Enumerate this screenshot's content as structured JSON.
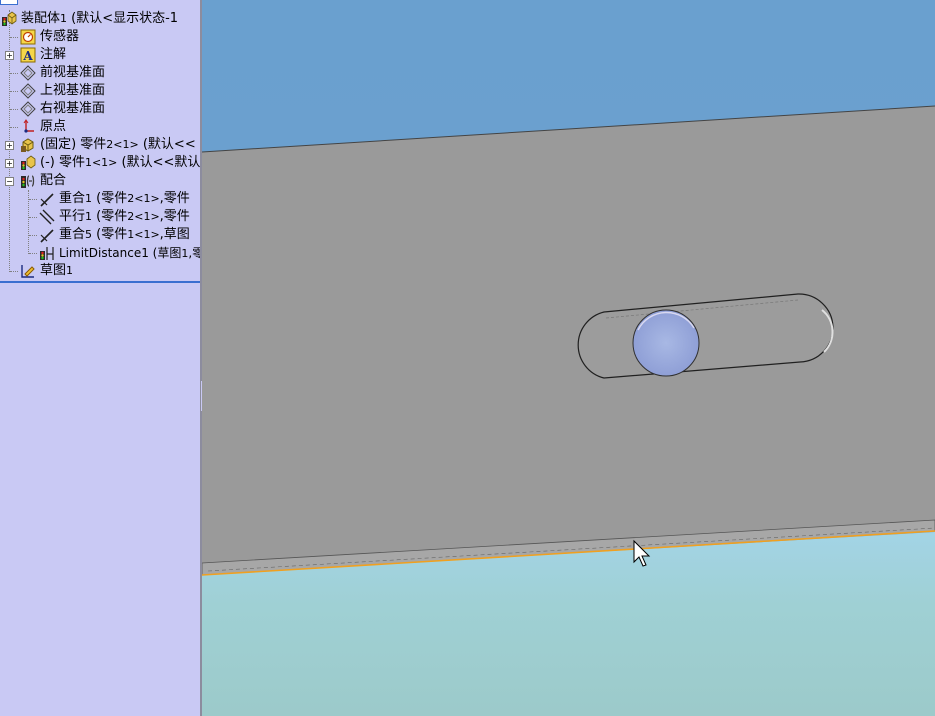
{
  "tree": {
    "root": {
      "prefix": "装配体",
      "sub": "1",
      "rest": " (默认<显示状态-1"
    },
    "items": [
      {
        "text": "传感器"
      },
      {
        "text": "注解"
      },
      {
        "text": "前视基准面"
      },
      {
        "text": "上视基准面"
      },
      {
        "text": "右视基准面"
      },
      {
        "text": "原点"
      },
      {
        "pre": "(固定) 零件",
        "sub": "2<1>",
        "post": " (默认<<"
      },
      {
        "pre": "(-) 零件",
        "sub": "1<1>",
        "post": " (默认<<默认"
      },
      {
        "text": "配合"
      },
      {
        "pre": "重合",
        "sub": "1",
        "post": " (零件",
        "sub2": "2<1>",
        "post2": ",零件"
      },
      {
        "pre": "平行",
        "sub": "1",
        "post": " (零件",
        "sub2": "2<1>",
        "post2": ",零件"
      },
      {
        "pre": "重合",
        "sub": "5",
        "post": " (零件",
        "sub2": "1<1>",
        "post2": ",草图"
      },
      {
        "pre": "LimitDistance1 (草图",
        "sub": "1",
        "post": ",零"
      },
      {
        "pre": "草图",
        "sub": "1",
        "post": ""
      }
    ]
  },
  "colors": {
    "panel_bg": "#c9c9f4",
    "sky_top": "#6aa0cf",
    "part_face": "#9a9a9a",
    "floor": "#9cd0d0",
    "edge_highlight": "#f0a020",
    "tree_end_line": "#3a6fd0"
  },
  "icons": [
    "assembly-icon",
    "sensor-icon",
    "annotation-icon",
    "plane-icon",
    "origin-icon",
    "part-fixed-icon",
    "part-floating-icon",
    "mates-icon",
    "coincident-mate-icon",
    "parallel-mate-icon",
    "limit-distance-mate-icon",
    "sketch-icon",
    "mouse-cursor-icon"
  ]
}
